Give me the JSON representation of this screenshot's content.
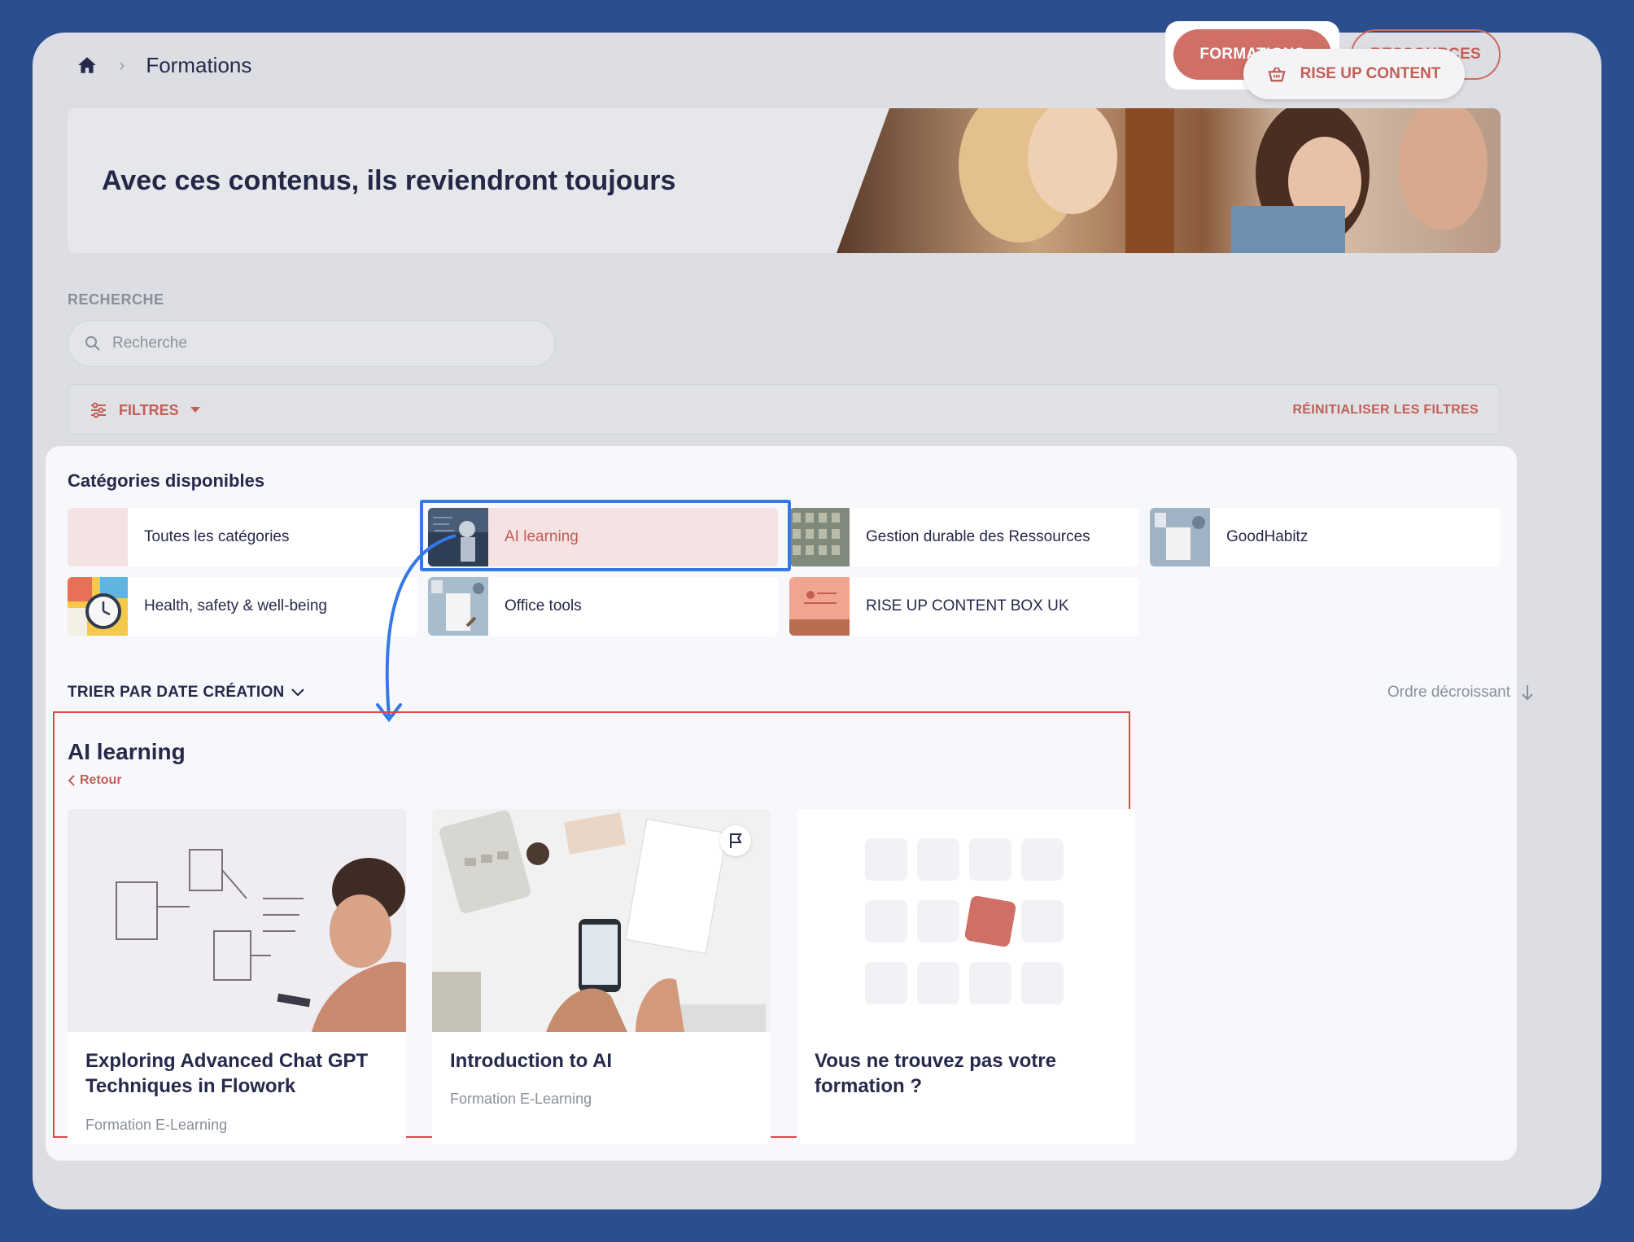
{
  "header": {
    "breadcrumb_current": "Formations",
    "tabs": [
      {
        "label": "FORMATIONS",
        "active": true
      },
      {
        "label": "RESSOURCES",
        "active": false
      }
    ]
  },
  "banner": {
    "title": "Avec ces contenus, ils reviendront toujours",
    "cta_label": "RISE UP CONTENT"
  },
  "search": {
    "label": "RECHERCHE",
    "placeholder": "Recherche",
    "value": ""
  },
  "filters": {
    "label": "FILTRES",
    "reset_label": "RÉINITIALISER LES FILTRES"
  },
  "categories": {
    "title": "Catégories disponibles",
    "items": [
      {
        "label": "Toutes les catégories",
        "thumb": "blank-thumb",
        "active": false
      },
      {
        "label": "AI learning",
        "thumb": "robot-thumb",
        "active": true
      },
      {
        "label": "Gestion durable des Ressources",
        "thumb": "building-thumb",
        "active": false
      },
      {
        "label": "GoodHabitz",
        "thumb": "desk-thumb",
        "active": false
      },
      {
        "label": "Health, safety & well-being",
        "thumb": "clock-thumb",
        "active": false
      },
      {
        "label": "Office tools",
        "thumb": "office-thumb",
        "active": false
      },
      {
        "label": "RISE UP CONTENT BOX UK",
        "thumb": "box-thumb",
        "active": false
      }
    ]
  },
  "sort": {
    "label": "TRIER PAR DATE CRÉATION",
    "order_label": "Ordre décroissant"
  },
  "section": {
    "title": "AI learning",
    "back_label": "Retour",
    "cards": [
      {
        "title": "Exploring Advanced Chat GPT Techniques in Flowork",
        "subtitle": "Formation E-Learning"
      },
      {
        "title": "Introduction to AI",
        "subtitle": "Formation E-Learning"
      },
      {
        "title": "Vous ne trouvez pas votre formation ?",
        "subtitle": ""
      }
    ]
  },
  "colors": {
    "background": "#2b4f8e",
    "accent": "#cf6f66",
    "highlight_blue": "#3579e6",
    "frame_red": "#e04848"
  }
}
